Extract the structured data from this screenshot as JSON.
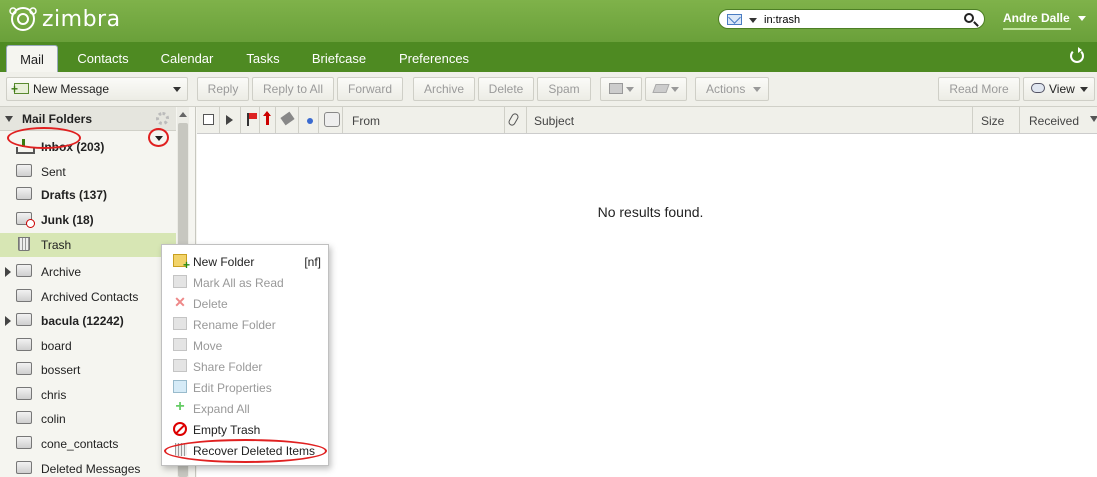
{
  "header": {
    "logo_text": "zimbra",
    "search_value": "in:trash",
    "user_name": "Andre Dalle"
  },
  "tabs": [
    {
      "label": "Mail",
      "active": true
    },
    {
      "label": "Contacts"
    },
    {
      "label": "Calendar"
    },
    {
      "label": "Tasks"
    },
    {
      "label": "Briefcase"
    },
    {
      "label": "Preferences"
    }
  ],
  "toolbar": {
    "new_message": "New Message",
    "reply": "Reply",
    "reply_all": "Reply to All",
    "forward": "Forward",
    "archive": "Archive",
    "delete": "Delete",
    "spam": "Spam",
    "actions": "Actions",
    "read_more": "Read More",
    "view": "View"
  },
  "sidebar": {
    "header": "Mail Folders",
    "folders": [
      {
        "label": "Inbox (203)",
        "bold": true,
        "icon": "inbox-icon"
      },
      {
        "label": "Sent",
        "icon": "folder-icon"
      },
      {
        "label": "Drafts (137)",
        "bold": true,
        "icon": "folder-icon"
      },
      {
        "label": "Junk (18)",
        "bold": true,
        "icon": "junk-folder-icon"
      },
      {
        "label": "Trash",
        "selected": true,
        "icon": "trash-icon"
      },
      {
        "label": "Archive",
        "expandable": true,
        "icon": "folder-icon"
      },
      {
        "label": "Archived Contacts",
        "icon": "folder-icon"
      },
      {
        "label": "bacula (12242)",
        "bold": true,
        "expandable": true,
        "icon": "folder-icon"
      },
      {
        "label": "board",
        "icon": "folder-icon"
      },
      {
        "label": "bossert",
        "icon": "folder-icon"
      },
      {
        "label": "chris",
        "icon": "folder-icon"
      },
      {
        "label": "colin",
        "icon": "folder-icon"
      },
      {
        "label": "cone_contacts",
        "icon": "folder-icon"
      },
      {
        "label": "Deleted Messages",
        "icon": "folder-icon"
      }
    ]
  },
  "list": {
    "columns": {
      "from": "From",
      "subject": "Subject",
      "size": "Size",
      "received": "Received"
    },
    "empty_message": "No results found."
  },
  "context_menu": {
    "items": [
      {
        "label": "New Folder",
        "shortcut": "[nf]",
        "enabled": true,
        "icon": "new-folder-icon"
      },
      {
        "label": "Mark All as Read",
        "enabled": false,
        "icon": "mark-read-icon"
      },
      {
        "label": "Delete",
        "enabled": false,
        "icon": "delete-x-icon"
      },
      {
        "label": "Rename Folder",
        "enabled": false,
        "icon": "rename-icon"
      },
      {
        "label": "Move",
        "enabled": false,
        "icon": "move-icon"
      },
      {
        "label": "Share Folder",
        "enabled": false,
        "icon": "share-icon"
      },
      {
        "label": "Edit Properties",
        "enabled": false,
        "icon": "edit-properties-icon"
      },
      {
        "label": "Expand All",
        "enabled": false,
        "icon": "expand-plus-icon"
      },
      {
        "label": "Empty Trash",
        "enabled": true,
        "icon": "empty-trash-icon"
      },
      {
        "label": "Recover Deleted Items",
        "enabled": true,
        "icon": "recover-trash-icon"
      }
    ]
  },
  "colors": {
    "header_green": "#6aa03a",
    "tabbar_green": "#4e8a22",
    "selected_folder": "#d7e6b4",
    "annotation_red": "#e02020"
  }
}
